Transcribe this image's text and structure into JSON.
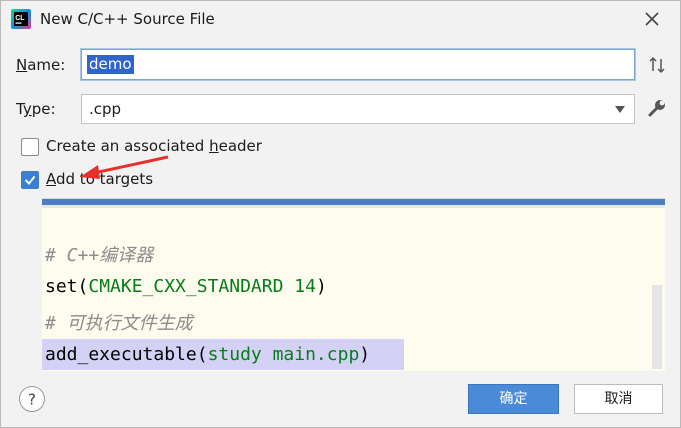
{
  "dialog": {
    "title": "New C/C++ Source File",
    "app_icon_label": "CL"
  },
  "form": {
    "name_label_key": "N",
    "name_label_rest": "ame:",
    "name_value": "demo",
    "type_label_pre": "T",
    "type_label_key": "y",
    "type_label_rest": "pe:",
    "type_value": ".cpp"
  },
  "options": {
    "header_label_pre": "Create an associated ",
    "header_label_key": "h",
    "header_label_rest": "eader",
    "header_checked": false,
    "targets_label_key": "A",
    "targets_label_rest": "dd to targets",
    "targets_checked": true
  },
  "code": {
    "line1": "# C++编译器",
    "line2_fn": "set(",
    "line2_arg": "CMAKE_CXX_STANDARD 14",
    "line2_end": ")",
    "line3": "# 可执行文件生成",
    "line4_fn": "add_executable(",
    "line4_arg": "study main.cpp",
    "line4_end": ")"
  },
  "buttons": {
    "ok": "确定",
    "cancel": "取消",
    "help": "?"
  },
  "colors": {
    "accent": "#4a8ad6",
    "annotation_arrow": "#e8302a",
    "selection": "#2f65ca"
  }
}
